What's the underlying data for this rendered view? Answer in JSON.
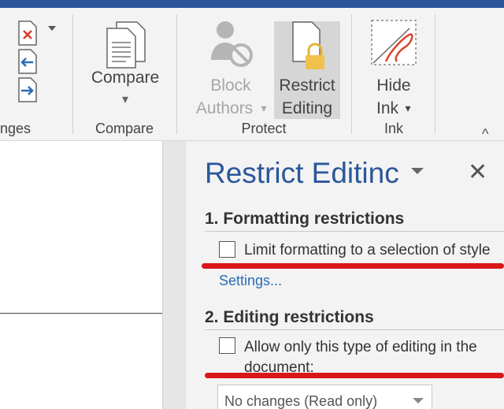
{
  "ribbon": {
    "groups": {
      "changes_partial": "nges",
      "compare": "Compare",
      "protect": "Protect",
      "ink": "Ink"
    },
    "buttons": {
      "compare": "Compare",
      "block_authors_line1": "Block",
      "block_authors_line2": "Authors",
      "restrict_editing_line1": "Restrict",
      "restrict_editing_line2": "Editing",
      "hide_ink_line1": "Hide",
      "hide_ink_line2": "Ink"
    },
    "dropdown_glyph": "▾",
    "collapse_glyph": "^"
  },
  "pane": {
    "title": "Restrict Editinc",
    "close": "✕",
    "formatting": {
      "heading": "1. Formatting restrictions",
      "checkbox_label": "Limit formatting to a selection of style",
      "settings_link": "Settings..."
    },
    "editing": {
      "heading": "2. Editing restrictions",
      "checkbox_label_line1": "Allow only this type of editing in the",
      "checkbox_label_line2": "document:",
      "selected_option": "No changes (Read only)"
    }
  },
  "colors": {
    "accent": "#2b579a",
    "annotation_red": "#d9161a",
    "link": "#2b6cb8"
  }
}
